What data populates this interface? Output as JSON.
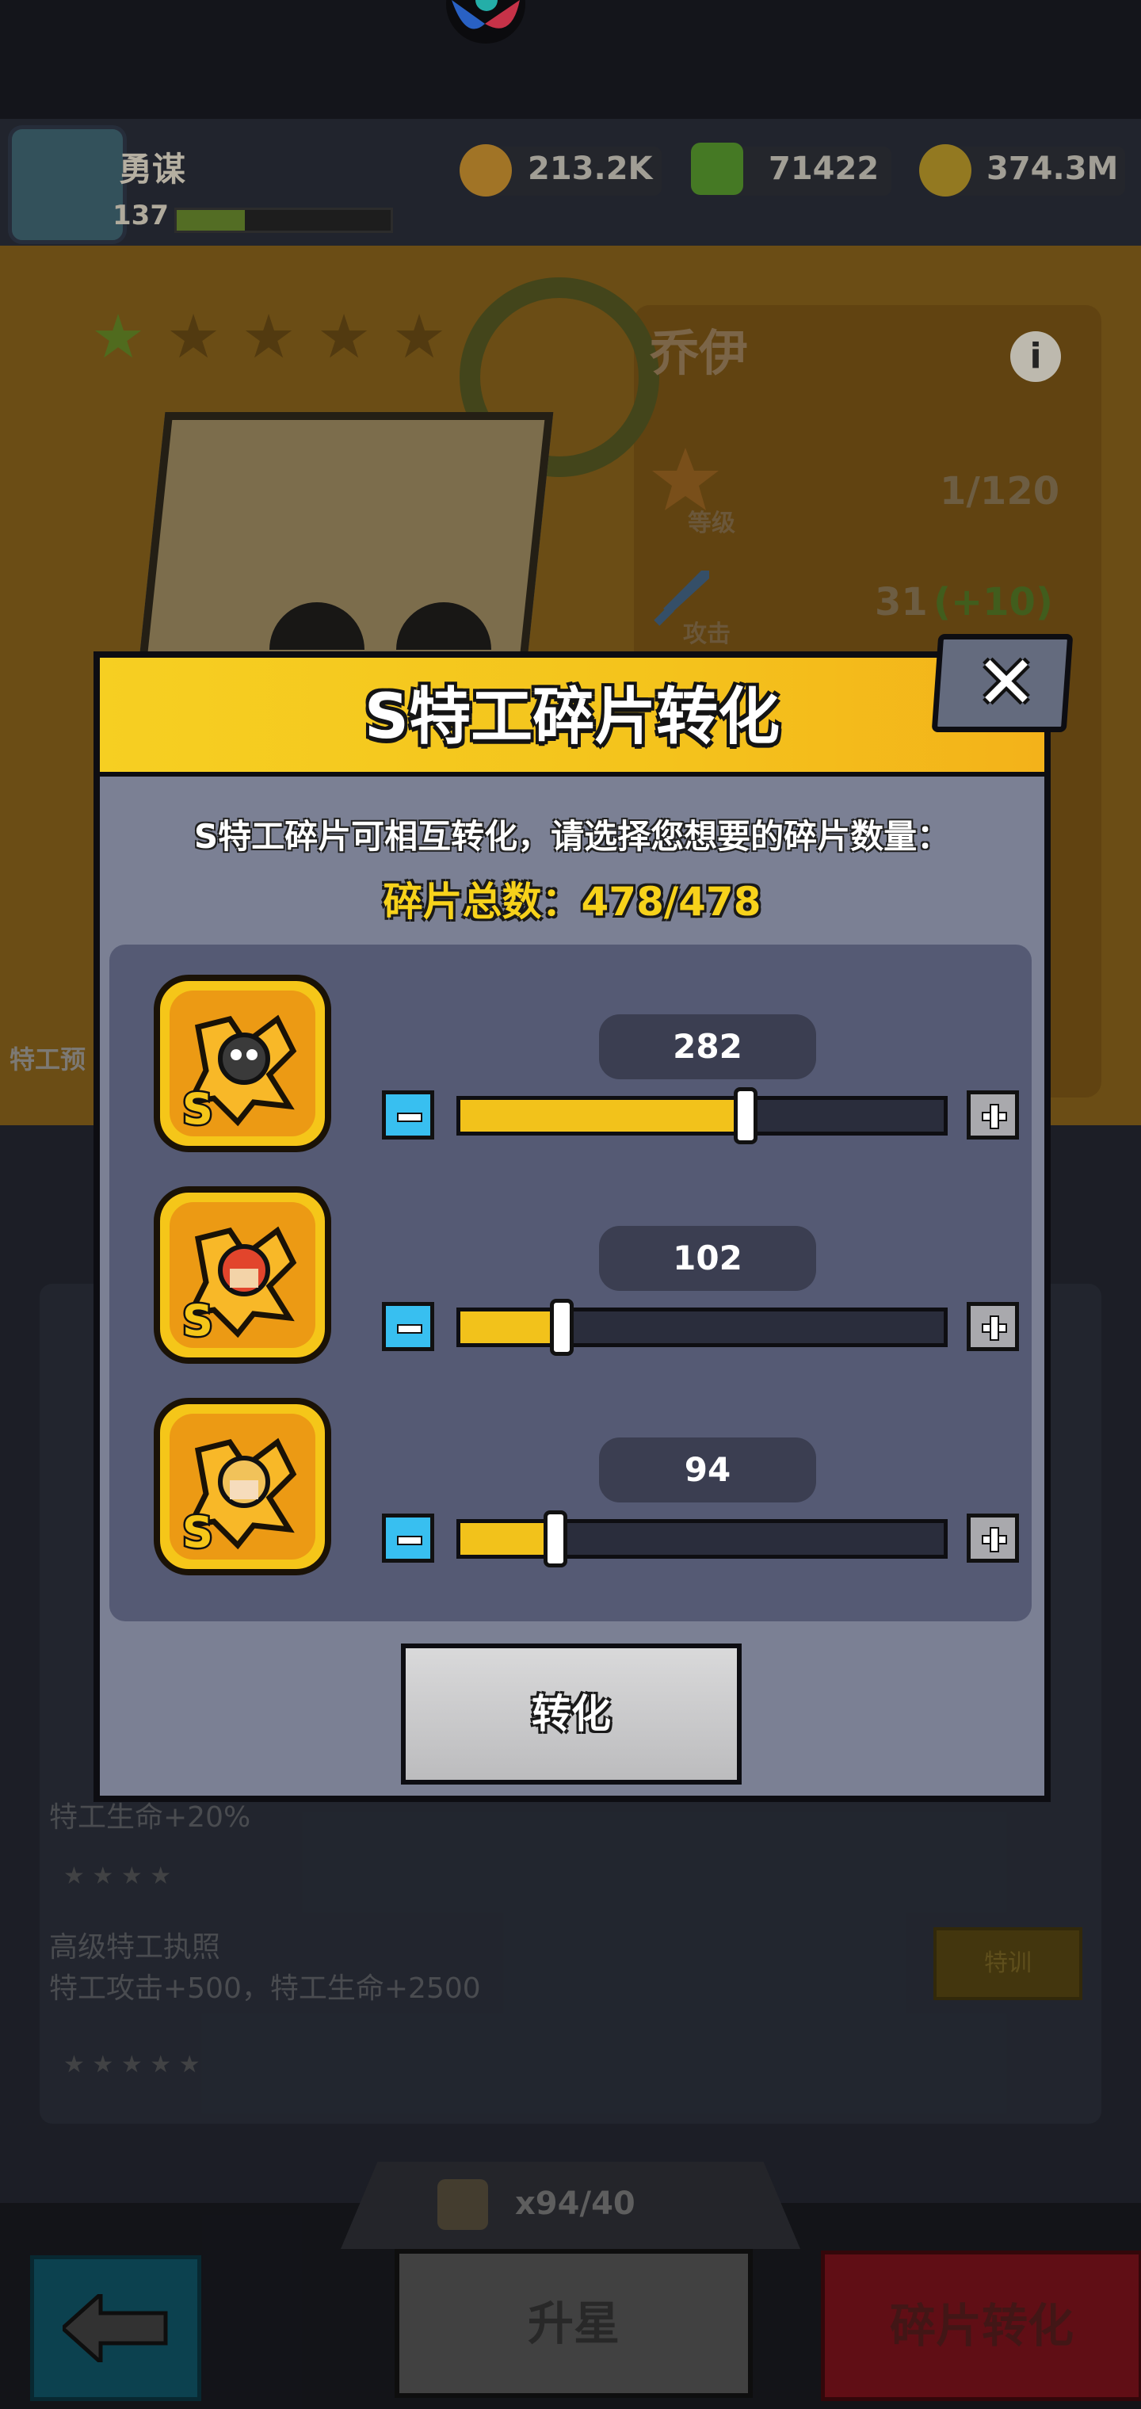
{
  "player": {
    "name": "勇谋",
    "level": "137"
  },
  "resources": [
    {
      "name": "energy",
      "value": "213.2K",
      "icon": "water-drop-icon",
      "color": "#e8a83a"
    },
    {
      "name": "gems",
      "value": "71422",
      "icon": "green-gem-icon",
      "color": "#63b935"
    },
    {
      "name": "coins",
      "value": "374.3M",
      "icon": "gold-coin-icon",
      "color": "#e0b52e"
    }
  ],
  "hero": {
    "name": "乔伊",
    "stars_lit": 1,
    "stars_total": 5,
    "stats": [
      {
        "label": "等级",
        "value": "1/120",
        "icon": "level-star-icon"
      },
      {
        "label": "攻击",
        "value": "31",
        "bonus": "(+10)",
        "icon": "sword-icon"
      }
    ]
  },
  "background_panel": {
    "side_label": "特工预",
    "talents": [
      {
        "text": "高级特工执照"
      },
      {
        "text": "特工攻击+500，特工生命+2500"
      },
      {
        "text": "特工生命+20%"
      }
    ],
    "train_label": "特训"
  },
  "bottom": {
    "fragment_count": "x94/40",
    "upgrade_star_label": "升星",
    "shard_convert_label": "碎片转化"
  },
  "modal": {
    "title": "S特工碎片转化",
    "close_symbol": "✕",
    "description": "S特工碎片可相互转化，请选择您想要的碎片数量：",
    "total_label": "碎片总数：478/478",
    "total_max": 478,
    "shards": [
      {
        "hero": "skull-masked agent",
        "value": "282",
        "fraction": 0.59,
        "badge": "S"
      },
      {
        "hero": "red-haired agent",
        "value": "102",
        "fraction": 0.21,
        "badge": "S"
      },
      {
        "hero": "blonde agent",
        "value": "94",
        "fraction": 0.197,
        "badge": "S"
      }
    ],
    "convert_label": "转化"
  },
  "colors": {
    "modal_header": "#f5c61e",
    "slider_fill": "#f2c21b",
    "minus_button": "#38bff0",
    "total_text": "#f7d21b"
  }
}
